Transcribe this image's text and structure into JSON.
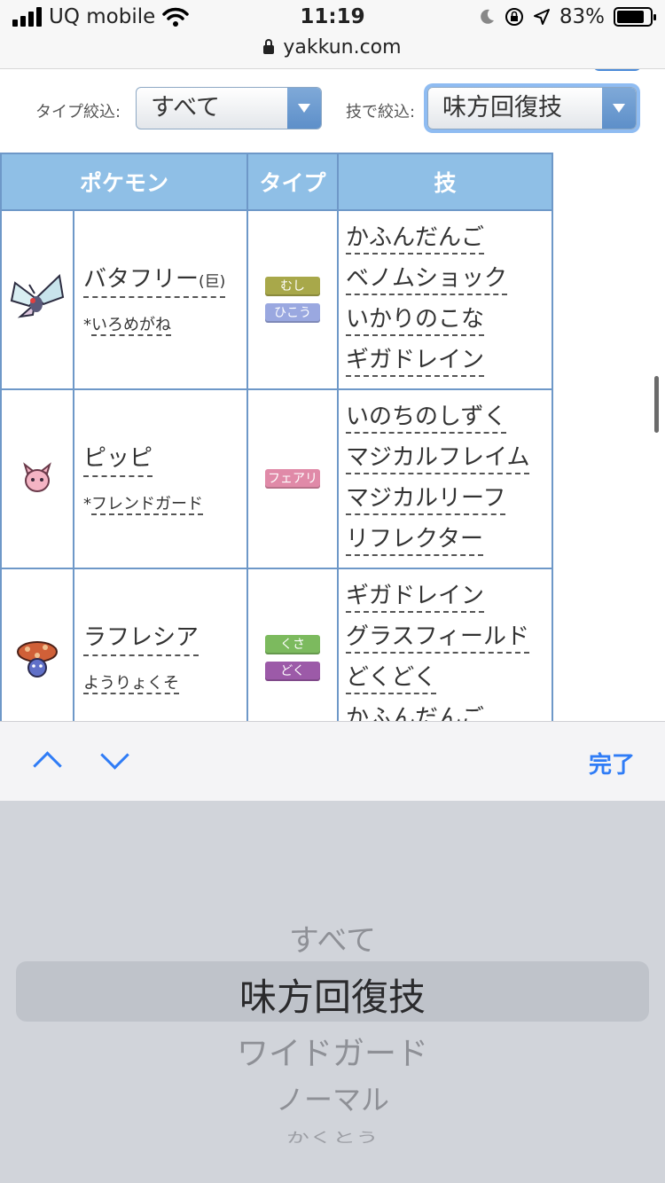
{
  "status": {
    "carrier": "UQ mobile",
    "time": "11:19",
    "battery": "83%",
    "battery_level": 0.83
  },
  "browser": {
    "url": "yakkun.com"
  },
  "filters": {
    "type_label": "タイプ絞込:",
    "type_value": "すべて",
    "move_label": "技で絞込:",
    "move_value": "味方回復技"
  },
  "table": {
    "headers": {
      "pokemon": "ポケモン",
      "type": "タイプ",
      "moves": "技"
    },
    "rows": [
      {
        "name": "バタフリー",
        "suffix": "(巨)",
        "ability_mark": "*",
        "ability": "いろめがね",
        "types": [
          {
            "label": "むし",
            "color": "#a8a84a"
          },
          {
            "label": "ひこう",
            "color": "#9aa8e0"
          }
        ],
        "moves": [
          "かふんだんご",
          "ベノムショック",
          "いかりのこな",
          "ギガドレイン"
        ]
      },
      {
        "name": "ピッピ",
        "suffix": "",
        "ability_mark": "*",
        "ability": "フレンドガード",
        "types": [
          {
            "label": "フェアリー",
            "color": "#e08aa8"
          }
        ],
        "moves": [
          "いのちのしずく",
          "マジカルフレイム",
          "マジカルリーフ",
          "リフレクター"
        ]
      },
      {
        "name": "ラフレシア",
        "suffix": "",
        "ability_mark": "",
        "ability": "ようりょくそ",
        "types": [
          {
            "label": "くさ",
            "color": "#7cba5e"
          },
          {
            "label": "どく",
            "color": "#9c5aa8"
          }
        ],
        "moves": [
          "ギガドレイン",
          "グラスフィールド",
          "どくどく",
          "かふんだんご"
        ]
      }
    ]
  },
  "accessory": {
    "done": "完了"
  },
  "picker": {
    "above": "すべて",
    "selected": "味方回復技",
    "below1": "ワイドガード",
    "below2": "ノーマル",
    "below3": "かくとう"
  }
}
